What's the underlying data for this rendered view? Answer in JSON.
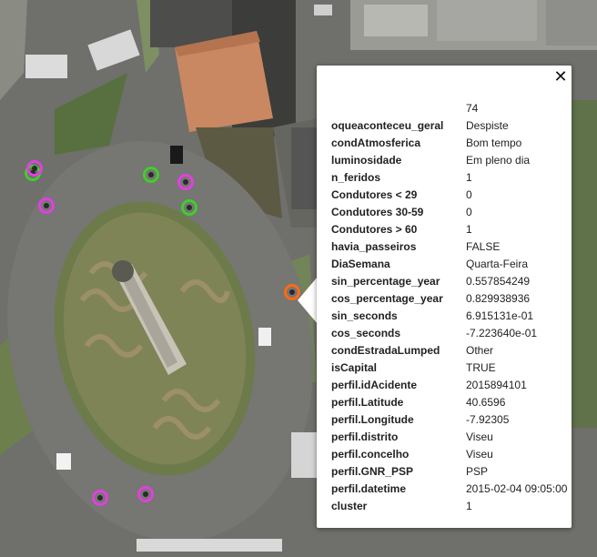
{
  "popup": {
    "close_label": "✕",
    "header_value": "74",
    "rows": [
      {
        "key": "oqueaconteceu_geral",
        "value": "Despiste"
      },
      {
        "key": "condAtmosferica",
        "value": "Bom tempo"
      },
      {
        "key": "luminosidade",
        "value": "Em pleno dia"
      },
      {
        "key": "n_feridos",
        "value": "1"
      },
      {
        "key": "Condutores < 29",
        "value": "0"
      },
      {
        "key": "Condutores 30-59",
        "value": "0"
      },
      {
        "key": "Condutores > 60",
        "value": "1"
      },
      {
        "key": "havia_passeiros",
        "value": "FALSE"
      },
      {
        "key": "DiaSemana",
        "value": "Quarta-Feira"
      },
      {
        "key": "sin_percentage_year",
        "value": "0.557854249"
      },
      {
        "key": "cos_percentage_year",
        "value": "0.829938936"
      },
      {
        "key": "sin_seconds",
        "value": "6.915131e-01"
      },
      {
        "key": "cos_seconds",
        "value": "-7.223640e-01"
      },
      {
        "key": "condEstradaLumped",
        "value": "Other"
      },
      {
        "key": "isCapital",
        "value": "TRUE"
      },
      {
        "key": "perfil.idAcidente",
        "value": "2015894101"
      },
      {
        "key": "perfil.Latitude",
        "value": "40.6596"
      },
      {
        "key": "perfil.Longitude",
        "value": "-7.92305"
      },
      {
        "key": "perfil.distrito",
        "value": "Viseu"
      },
      {
        "key": "perfil.concelho",
        "value": "Viseu"
      },
      {
        "key": "perfil.GNR_PSP",
        "value": "PSP"
      },
      {
        "key": "perfil.datetime",
        "value": "2015-02-04 09:05:00"
      },
      {
        "key": "cluster",
        "value": "1"
      }
    ]
  },
  "markers": [
    {
      "name": "accident-marker-green",
      "color": "#3fcf2a"
    },
    {
      "name": "accident-marker-green",
      "color": "#3fcf2a"
    },
    {
      "name": "accident-marker-green",
      "color": "#3fcf2a"
    },
    {
      "name": "accident-marker-magenta",
      "color": "#e040e0"
    },
    {
      "name": "accident-marker-magenta",
      "color": "#e040e0"
    },
    {
      "name": "accident-marker-magenta",
      "color": "#e040e0"
    },
    {
      "name": "accident-marker-magenta",
      "color": "#e040e0"
    },
    {
      "name": "accident-marker-magenta",
      "color": "#e040e0"
    },
    {
      "name": "accident-marker-selected-orange",
      "color": "#ff6a13"
    }
  ]
}
